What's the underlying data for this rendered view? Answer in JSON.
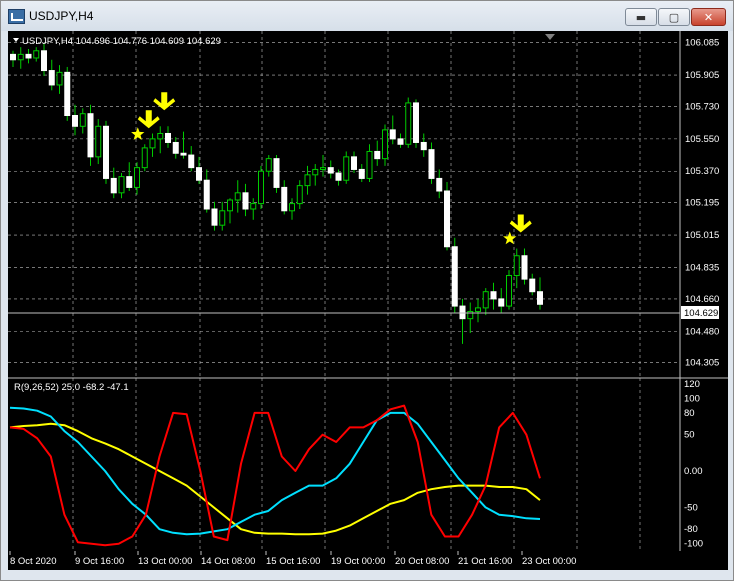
{
  "window": {
    "title": "USDJPY,H4"
  },
  "buttons": {
    "minimize": "▬",
    "maximize": "▢",
    "close": "✕"
  },
  "main_chart": {
    "info_label": "USDJPY,H4  104.696 104.776 104.609 104.629",
    "price_levels": [
      "106.085",
      "105.905",
      "105.730",
      "105.550",
      "105.370",
      "105.195",
      "105.015",
      "104.835",
      "104.660",
      "104.480",
      "104.305"
    ],
    "current_price": "104.629",
    "bull_color": "#ffffff",
    "bear_color": "#ffffff",
    "wick_color": "#00cc00",
    "grid_color": "#c0c0c0",
    "signal_color": "#ffff00"
  },
  "indicator": {
    "label": "R(9,26,52) 25.0 -68.2 -47.1",
    "levels": [
      "120",
      "100",
      "80",
      "50",
      "0.00",
      "-50",
      "-80",
      "-100"
    ],
    "lines": [
      {
        "name": "R9",
        "color": "#ff0000"
      },
      {
        "name": "R26",
        "color": "#00e0ff"
      },
      {
        "name": "R52",
        "color": "#ffff00"
      }
    ]
  },
  "time_axis": [
    "8 Oct 2020",
    "9 Oct 16:00",
    "13 Oct 00:00",
    "14 Oct 08:00",
    "15 Oct 16:00",
    "19 Oct 00:00",
    "20 Oct 08:00",
    "21 Oct 16:00",
    "23 Oct 00:00"
  ],
  "chart_data": {
    "type": "candlestick",
    "symbol": "USDJPY",
    "timeframe": "H4",
    "ylim": [
      104.22,
      106.15
    ],
    "candles": [
      [
        106.02,
        106.04,
        105.95,
        105.99
      ],
      [
        105.99,
        106.06,
        105.94,
        106.02
      ],
      [
        106.02,
        106.05,
        105.97,
        106.0
      ],
      [
        106.0,
        106.06,
        105.98,
        106.04
      ],
      [
        106.04,
        106.08,
        105.9,
        105.93
      ],
      [
        105.93,
        105.99,
        105.82,
        105.85
      ],
      [
        105.85,
        105.96,
        105.8,
        105.92
      ],
      [
        105.92,
        105.95,
        105.65,
        105.68
      ],
      [
        105.68,
        105.74,
        105.57,
        105.62
      ],
      [
        105.62,
        105.72,
        105.58,
        105.69
      ],
      [
        105.69,
        105.74,
        105.4,
        105.45
      ],
      [
        105.45,
        105.66,
        105.41,
        105.62
      ],
      [
        105.62,
        105.65,
        105.3,
        105.33
      ],
      [
        105.33,
        105.39,
        105.22,
        105.25
      ],
      [
        105.25,
        105.36,
        105.22,
        105.34
      ],
      [
        105.34,
        105.42,
        105.26,
        105.28
      ],
      [
        105.28,
        105.42,
        105.24,
        105.39
      ],
      [
        105.39,
        105.52,
        105.37,
        105.5
      ],
      [
        105.5,
        105.58,
        105.45,
        105.55
      ],
      [
        105.55,
        105.62,
        105.47,
        105.58
      ],
      [
        105.58,
        105.62,
        105.5,
        105.53
      ],
      [
        105.53,
        105.56,
        105.44,
        105.47
      ],
      [
        105.47,
        105.59,
        105.44,
        105.46
      ],
      [
        105.46,
        105.51,
        105.37,
        105.39
      ],
      [
        105.39,
        105.45,
        105.3,
        105.32
      ],
      [
        105.32,
        105.38,
        105.14,
        105.16
      ],
      [
        105.16,
        105.2,
        105.04,
        105.07
      ],
      [
        105.07,
        105.2,
        105.04,
        105.15
      ],
      [
        105.15,
        105.22,
        105.08,
        105.21
      ],
      [
        105.21,
        105.32,
        105.14,
        105.25
      ],
      [
        105.25,
        105.3,
        105.12,
        105.16
      ],
      [
        105.16,
        105.22,
        105.1,
        105.19
      ],
      [
        105.19,
        105.4,
        105.16,
        105.37
      ],
      [
        105.37,
        105.46,
        105.34,
        105.44
      ],
      [
        105.44,
        105.46,
        105.25,
        105.28
      ],
      [
        105.28,
        105.32,
        105.13,
        105.15
      ],
      [
        105.15,
        105.22,
        105.1,
        105.19
      ],
      [
        105.19,
        105.32,
        105.16,
        105.29
      ],
      [
        105.29,
        105.4,
        105.24,
        105.35
      ],
      [
        105.35,
        105.41,
        105.29,
        105.38
      ],
      [
        105.38,
        105.46,
        105.34,
        105.39
      ],
      [
        105.39,
        105.43,
        105.33,
        105.36
      ],
      [
        105.36,
        105.38,
        105.29,
        105.32
      ],
      [
        105.32,
        105.48,
        105.3,
        105.45
      ],
      [
        105.45,
        105.48,
        105.36,
        105.38
      ],
      [
        105.38,
        105.41,
        105.31,
        105.33
      ],
      [
        105.33,
        105.52,
        105.31,
        105.48
      ],
      [
        105.48,
        105.54,
        105.4,
        105.44
      ],
      [
        105.44,
        105.63,
        105.4,
        105.6
      ],
      [
        105.6,
        105.68,
        105.52,
        105.55
      ],
      [
        105.55,
        105.58,
        105.5,
        105.52
      ],
      [
        105.52,
        105.78,
        105.5,
        105.75
      ],
      [
        105.75,
        105.77,
        105.5,
        105.53
      ],
      [
        105.53,
        105.58,
        105.45,
        105.49
      ],
      [
        105.49,
        105.53,
        105.3,
        105.33
      ],
      [
        105.33,
        105.38,
        105.22,
        105.26
      ],
      [
        105.26,
        105.31,
        104.93,
        104.95
      ],
      [
        104.95,
        105.0,
        104.58,
        104.62
      ],
      [
        104.62,
        104.66,
        104.41,
        104.55
      ],
      [
        104.55,
        104.64,
        104.47,
        104.59
      ],
      [
        104.59,
        104.66,
        104.53,
        104.61
      ],
      [
        104.61,
        104.72,
        104.57,
        104.7
      ],
      [
        104.7,
        104.75,
        104.6,
        104.66
      ],
      [
        104.66,
        104.72,
        104.58,
        104.62
      ],
      [
        104.62,
        104.82,
        104.6,
        104.79
      ],
      [
        104.79,
        104.94,
        104.72,
        104.9
      ],
      [
        104.9,
        104.94,
        104.74,
        104.77
      ],
      [
        104.77,
        104.8,
        104.68,
        104.7
      ],
      [
        104.7,
        104.78,
        104.6,
        104.63
      ]
    ],
    "indicator_series": {
      "ylim": [
        -110,
        128
      ],
      "r9": [
        60,
        58,
        45,
        20,
        -60,
        -98,
        -100,
        -102,
        -100,
        -90,
        -60,
        20,
        80,
        78,
        0,
        -90,
        -95,
        10,
        80,
        80,
        20,
        0,
        30,
        50,
        40,
        60,
        60,
        70,
        85,
        90,
        40,
        -60,
        -90,
        -90,
        -60,
        -20,
        60,
        80,
        50,
        -10
      ],
      "r26": [
        87,
        86,
        83,
        75,
        55,
        40,
        20,
        0,
        -25,
        -45,
        -60,
        -80,
        -85,
        -87,
        -86,
        -83,
        -80,
        -70,
        -60,
        -55,
        -40,
        -30,
        -20,
        -20,
        -10,
        10,
        40,
        70,
        80,
        80,
        65,
        40,
        15,
        -10,
        -30,
        -50,
        -60,
        -62,
        -65,
        -66
      ],
      "r52": [
        60,
        62,
        63,
        65,
        63,
        55,
        45,
        38,
        30,
        20,
        10,
        0,
        -10,
        -20,
        -35,
        -50,
        -65,
        -80,
        -85,
        -86,
        -86,
        -87,
        -87,
        -86,
        -82,
        -75,
        -65,
        -55,
        -45,
        -40,
        -30,
        -25,
        -22,
        -20,
        -20,
        -20,
        -22,
        -22,
        -25,
        -40
      ]
    },
    "signals": [
      {
        "candle": 17,
        "star": true,
        "arrow": true
      },
      {
        "candle": 19,
        "star": false,
        "arrow": true
      },
      {
        "candle": 65,
        "star": true,
        "arrow": true
      }
    ]
  }
}
